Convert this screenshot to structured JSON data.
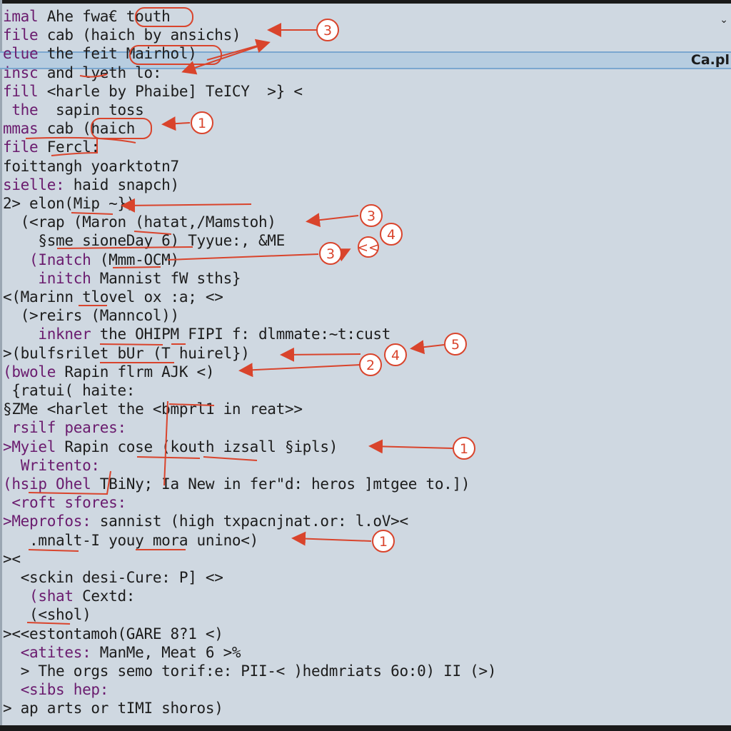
{
  "editor": {
    "collapse_icon": "chevron-down-icon",
    "highlighted_row_right_label": "Ca.pl",
    "lines": [
      {
        "indent": "",
        "kw": "imal",
        "rest": " Ahe fwa€ touth"
      },
      {
        "indent": "",
        "kw": "file",
        "rest": " cab (haich by ansichs)"
      },
      {
        "indent": "",
        "kw": "elue",
        "rest": " the feit Mairhol)"
      },
      {
        "indent": "",
        "kw": "insc",
        "rest": " and lyeth lo:"
      },
      {
        "indent": "",
        "kw": "fill",
        "rest": " <harle by Phaibe] TeICY  >} <"
      },
      {
        "indent": " ",
        "kw": "the",
        "rest": "  sapin toss"
      },
      {
        "indent": "",
        "kw": "mmas",
        "rest": " cab (haich"
      },
      {
        "indent": "",
        "kw": "file",
        "rest": " Fercl:"
      },
      {
        "indent": "",
        "kw": "",
        "rest": "foittangh yoarktotn7"
      },
      {
        "indent": "",
        "kw": "sielle:",
        "rest": " haid snapch)"
      },
      {
        "indent": "",
        "kw": "",
        "rest": "2> elon(Mip ~})"
      },
      {
        "indent": "  ",
        "kw": "",
        "rest": "(<rap (Maron (hatat,/Mamstoh)"
      },
      {
        "indent": "    ",
        "kw": "",
        "rest": "§sme sioneDay 6) Tyyue:, &ME"
      },
      {
        "indent": "   ",
        "kw": "(Inatch",
        "rest": " (Mmm-OCM)"
      },
      {
        "indent": "    ",
        "kw": "initch",
        "rest": " Mannist fW sths}"
      },
      {
        "indent": "",
        "kw": "",
        "rest": "<(Marinn tlovel ox :a; <>"
      },
      {
        "indent": "  ",
        "kw": "",
        "rest": "(>reirs (Manncol))"
      },
      {
        "indent": "   ",
        "kw": " inkner",
        "rest": " the OHIPM FIPI f: dlmmate:~t:cust"
      },
      {
        "indent": "",
        "kw": "",
        "rest": ">(bulfsrilet bUr (T huirel})"
      },
      {
        "indent": "",
        "kw": "(bwole",
        "rest": " Rapin flrm AJK <)"
      },
      {
        "indent": " ",
        "kw": "",
        "rest": "{ratui( haite:"
      },
      {
        "indent": "",
        "kw": "",
        "rest": "§ZMe <harlet the <bmprl1 in reat>>"
      },
      {
        "indent": " ",
        "kw": "rsilf peares:",
        "rest": ""
      },
      {
        "indent": "",
        "kw": ">Myiel",
        "rest": " Rapin cose (kouth izsall §ipls)"
      },
      {
        "indent": "  ",
        "kw": "Writento:",
        "rest": ""
      },
      {
        "indent": "",
        "kw": "(hsip Ohel",
        "rest": " TBiNy; Ia New in fer\"d: heros ]mtgee to.])"
      },
      {
        "indent": " ",
        "kw": "<roft sfores:",
        "rest": ""
      },
      {
        "indent": "",
        "kw": ">Meprofos:",
        "rest": " sannist (high txpacnjnat.or: l.oV><"
      },
      {
        "indent": "   ",
        "kw": "",
        "rest": ".mnalt-I youy mora unino<)"
      },
      {
        "indent": "",
        "kw": "",
        "rest": "><"
      },
      {
        "indent": "  ",
        "kw": "",
        "rest": "<sckin desi-Cure: P] <>"
      },
      {
        "indent": "   ",
        "kw": "(shat",
        "rest": " Cextd:"
      },
      {
        "indent": "   ",
        "kw": "",
        "rest": "(<shol)"
      },
      {
        "indent": "",
        "kw": "",
        "rest": "><<estontamoh(GARE 8?1 <)"
      },
      {
        "indent": "  ",
        "kw": "<atites:",
        "rest": " ManMe, Meat 6 >%"
      },
      {
        "indent": "  ",
        "kw": "",
        "rest": "> The orgs semo torif:e: PII-< )hedmriats 6o:0) II (>)"
      },
      {
        "indent": "  ",
        "kw": "<sibs hep:",
        "rest": ""
      },
      {
        "indent": "",
        "kw": "",
        "rest": "> ap arts or tIMI shoros)"
      }
    ]
  },
  "annotations": {
    "color": "#d9442c",
    "badges": [
      "3",
      "1",
      "3",
      "4",
      "3",
      "5",
      "4",
      "2",
      "1",
      "1"
    ]
  }
}
